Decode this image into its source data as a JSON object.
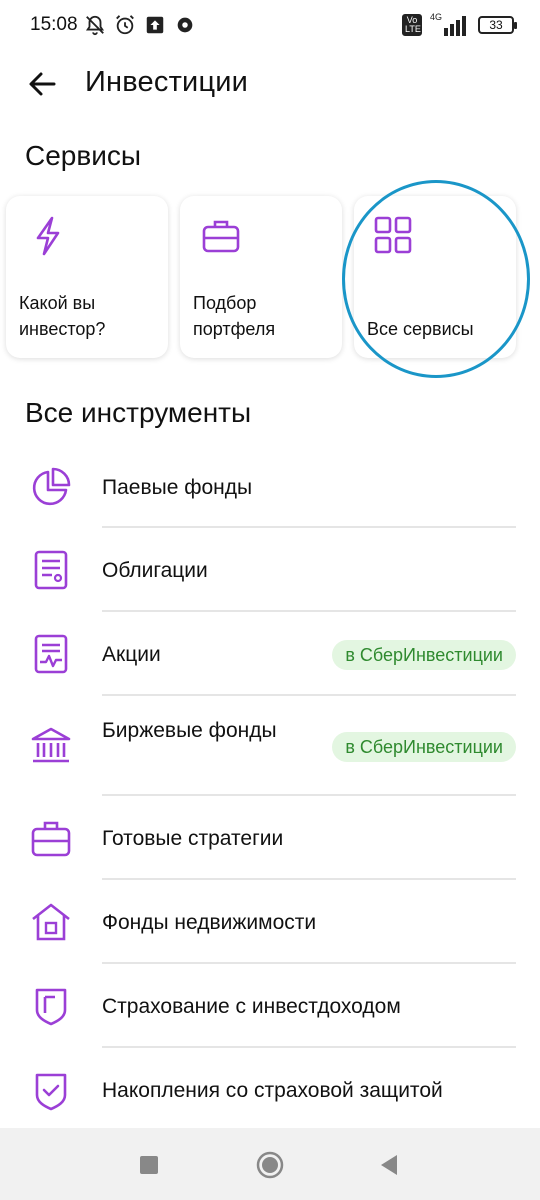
{
  "status_bar": {
    "time": "15:08",
    "network": "4G",
    "volte": "Vo LTE",
    "battery": "33"
  },
  "header": {
    "title": "Инвестиции"
  },
  "services": {
    "title": "Сервисы",
    "cards": [
      {
        "label": "Какой вы инвестор?",
        "icon": "lightning-icon"
      },
      {
        "label": "Подбор портфеля",
        "icon": "briefcase-icon"
      },
      {
        "label": "Все сервисы",
        "icon": "grid-icon"
      }
    ]
  },
  "instruments": {
    "title": "Все инструменты",
    "items": [
      {
        "label": "Паевые фонды",
        "icon": "pie-chart-icon",
        "badge": ""
      },
      {
        "label": "Облигации",
        "icon": "bond-document-icon",
        "badge": ""
      },
      {
        "label": "Акции",
        "icon": "stock-document-icon",
        "badge": "в СберИнвестиции"
      },
      {
        "label": "Биржевые фонды",
        "icon": "exchange-building-icon",
        "badge": "в СберИнвестиции"
      },
      {
        "label": "Готовые стратегии",
        "icon": "briefcase-icon",
        "badge": ""
      },
      {
        "label": "Фонды недвижимости",
        "icon": "house-icon",
        "badge": ""
      },
      {
        "label": "Страхование с инвестдоходом",
        "icon": "shield-icon",
        "badge": ""
      },
      {
        "label": "Накопления со страховой защитой",
        "icon": "shield-check-icon",
        "badge": ""
      }
    ]
  },
  "colors": {
    "accent": "#9b3fd6",
    "badge_bg": "#e3f6e1",
    "badge_text": "#2f8a2f",
    "highlight": "#1a96c8"
  }
}
